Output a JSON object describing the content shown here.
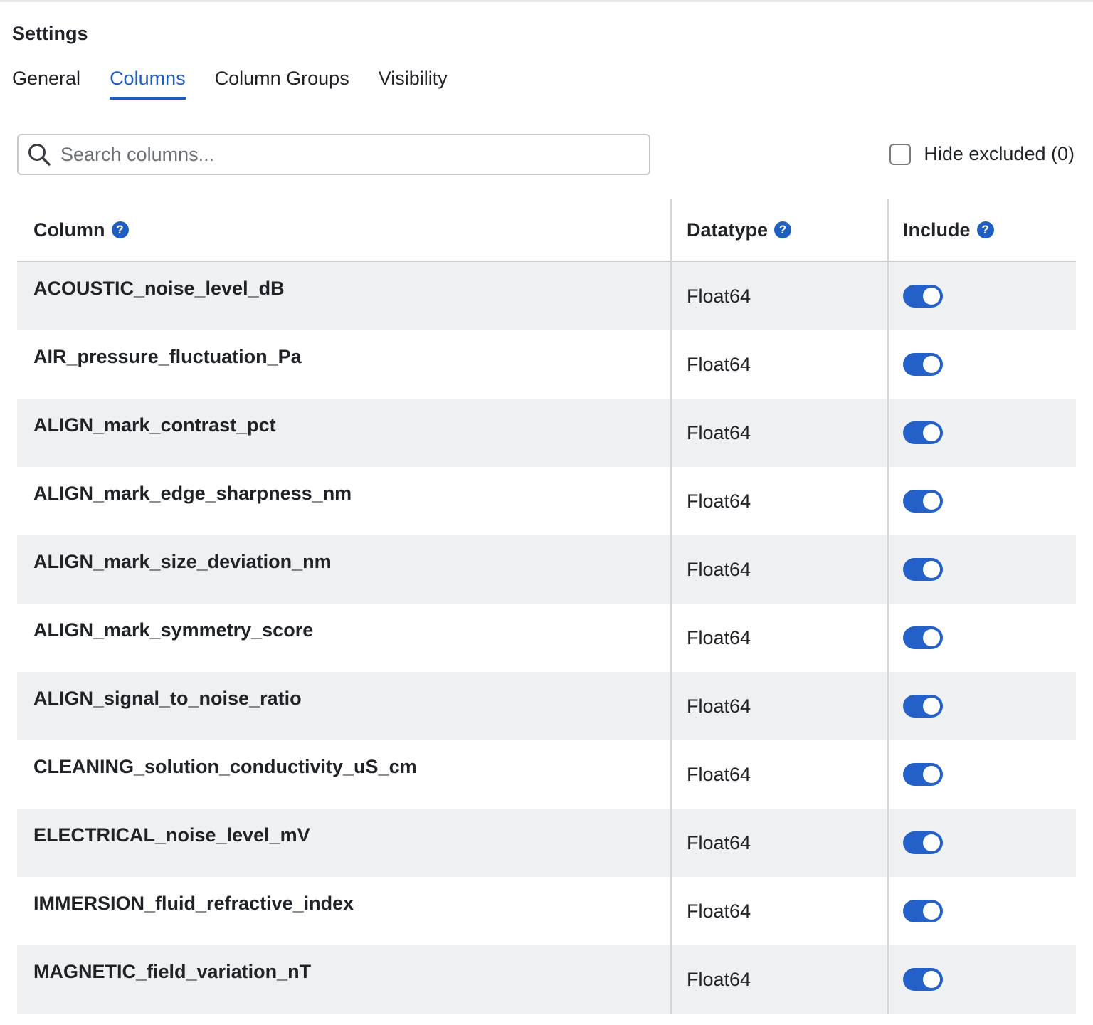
{
  "header": {
    "title": "Settings"
  },
  "tabs": [
    {
      "label": "General",
      "active": false
    },
    {
      "label": "Columns",
      "active": true
    },
    {
      "label": "Column Groups",
      "active": false
    },
    {
      "label": "Visibility",
      "active": false
    }
  ],
  "search": {
    "placeholder": "Search columns...",
    "value": "",
    "icon": "search-icon"
  },
  "hide_excluded": {
    "label": "Hide excluded (0)",
    "checked": false
  },
  "table": {
    "headers": {
      "column": "Column",
      "datatype": "Datatype",
      "include": "Include",
      "help_glyph": "?"
    },
    "rows": [
      {
        "name": "ACOUSTIC_noise_level_dB",
        "datatype": "Float64",
        "include": true
      },
      {
        "name": "AIR_pressure_fluctuation_Pa",
        "datatype": "Float64",
        "include": true
      },
      {
        "name": "ALIGN_mark_contrast_pct",
        "datatype": "Float64",
        "include": true
      },
      {
        "name": "ALIGN_mark_edge_sharpness_nm",
        "datatype": "Float64",
        "include": true
      },
      {
        "name": "ALIGN_mark_size_deviation_nm",
        "datatype": "Float64",
        "include": true
      },
      {
        "name": "ALIGN_mark_symmetry_score",
        "datatype": "Float64",
        "include": true
      },
      {
        "name": "ALIGN_signal_to_noise_ratio",
        "datatype": "Float64",
        "include": true
      },
      {
        "name": "CLEANING_solution_conductivity_uS_cm",
        "datatype": "Float64",
        "include": true
      },
      {
        "name": "ELECTRICAL_noise_level_mV",
        "datatype": "Float64",
        "include": true
      },
      {
        "name": "IMMERSION_fluid_refractive_index",
        "datatype": "Float64",
        "include": true
      },
      {
        "name": "MAGNETIC_field_variation_nT",
        "datatype": "Float64",
        "include": true
      }
    ]
  },
  "colors": {
    "accent": "#1f5fbf",
    "toggle_on": "#2361c9",
    "stripe": "#eff0f2"
  }
}
